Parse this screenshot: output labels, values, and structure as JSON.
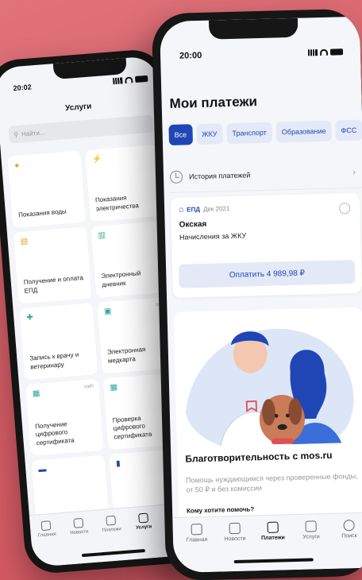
{
  "back_phone": {
    "status_time": "20:02",
    "title": "Услуги",
    "search_placeholder": "Найти...",
    "tiles": [
      {
        "label": "Показания воды",
        "icon": "water-drop-icon",
        "icon_color": "#f0a030",
        "badge": ""
      },
      {
        "label": "Показания электричества",
        "icon": "lightning-icon",
        "icon_color": "#f0a030",
        "badge": ""
      },
      {
        "label": "Получение и оплата ЕПД",
        "icon": "document-icon",
        "icon_color": "#f0a030",
        "badge": ""
      },
      {
        "label": "Электронный дневник",
        "icon": "book-icon",
        "icon_color": "#3cb371",
        "badge": ""
      },
      {
        "label": "Запись к врачу и ветеринару",
        "icon": "plus-icon",
        "icon_color": "#2aa6a0",
        "badge": ""
      },
      {
        "label": "Электронная медкарта",
        "icon": "medcard-icon",
        "icon_color": "#2aa6a0",
        "badge": "сайт"
      },
      {
        "label": "Получение цифрового сертификата",
        "icon": "qr-icon",
        "icon_color": "#2aa6a0",
        "badge": "сайт"
      },
      {
        "label": "Проверка цифрового сертификата",
        "icon": "qr-icon",
        "icon_color": "#2aa6a0",
        "badge": ""
      },
      {
        "label": "",
        "icon": "car-icon",
        "icon_color": "#1f46b4",
        "badge": ""
      },
      {
        "label": "",
        "icon": "card-icon",
        "icon_color": "#1f46b4",
        "badge": ""
      }
    ],
    "tabbar": [
      {
        "label": "Главная",
        "icon": "home-icon",
        "active": false
      },
      {
        "label": "Новости",
        "icon": "news-icon",
        "active": false
      },
      {
        "label": "Платежи",
        "icon": "payments-icon",
        "active": false
      },
      {
        "label": "Услуги",
        "icon": "services-icon",
        "active": true
      },
      {
        "label": "Поиск",
        "icon": "search-icon",
        "active": false
      }
    ]
  },
  "front_phone": {
    "status_time": "20:00",
    "title": "Мои платежи",
    "chips": [
      {
        "label": "Все",
        "active": true
      },
      {
        "label": "ЖКУ",
        "active": false
      },
      {
        "label": "Транспорт",
        "active": false
      },
      {
        "label": "Образование",
        "active": false
      },
      {
        "label": "ФСС",
        "active": false
      }
    ],
    "history_label": "История платежей",
    "bill": {
      "code": "ЕПД",
      "date": "Дек 2021",
      "name": "Окская",
      "description": "Начисления за ЖКУ",
      "pay_label": "Оплатить 4 989,98 ₽"
    },
    "charity": {
      "title": "Благотворительность с mos.ru",
      "description": "Помощь нуждающимся через проверенные фонды, от 50 ₽ и без комиссии",
      "question": "Кому хотите помочь?"
    },
    "tabbar": [
      {
        "label": "Главная",
        "icon": "home-icon",
        "active": false
      },
      {
        "label": "Новости",
        "icon": "news-icon",
        "active": false
      },
      {
        "label": "Платежи",
        "icon": "payments-icon",
        "active": true
      },
      {
        "label": "Услуги",
        "icon": "services-icon",
        "active": false
      },
      {
        "label": "Поиск",
        "icon": "search-icon",
        "active": false
      }
    ]
  },
  "colors": {
    "background": "#d9636b",
    "accent": "#1f46b4",
    "chip_bg": "#e4e9f7"
  }
}
